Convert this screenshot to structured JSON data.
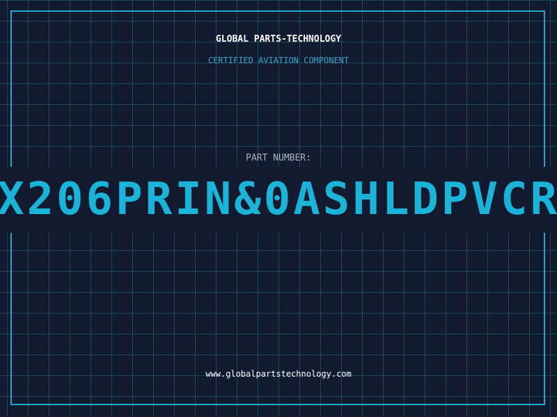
{
  "header": {
    "company": "GLOBAL PARTS-TECHNOLOGY",
    "subtitle": "CERTIFIED AVIATION COMPONENT"
  },
  "part": {
    "label": "PART NUMBER:",
    "number": "X206PRIN&0ASHLDPVCR"
  },
  "footer": {
    "url": "www.globalpartstechnology.com"
  },
  "colors": {
    "background": "#111a2e",
    "grid": "#1f4a5e",
    "accent": "#22a8cc",
    "part_number": "#1cb3d9"
  }
}
